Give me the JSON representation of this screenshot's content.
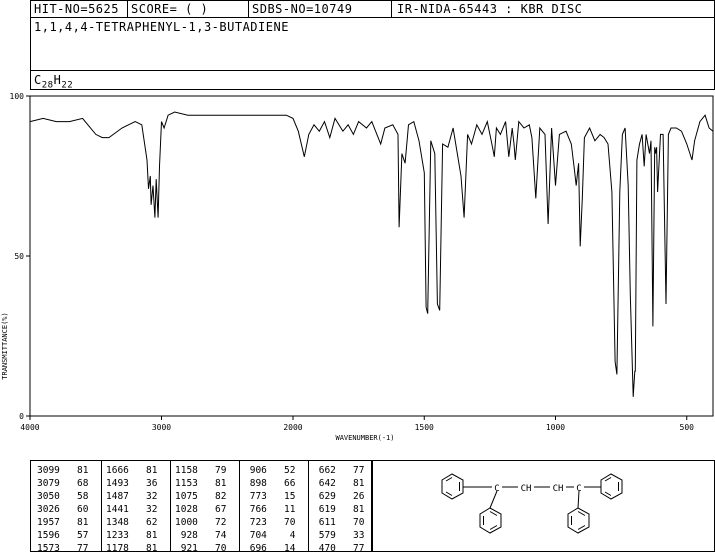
{
  "header": {
    "hit_no": "HIT-NO=5625",
    "score": "SCORE=  (   )",
    "sdbs_no": "SDBS-NO=10749",
    "ir_id": "IR-NIDA-65443 : KBR DISC",
    "compound": "1,1,4,4-TETRAPHENYL-1,3-BUTADIENE",
    "formula_base": "C",
    "formula_c": "28",
    "formula_h_label": "H",
    "formula_h": "22"
  },
  "chart_data": {
    "type": "line",
    "xlabel": "WAVENUMBER(-1)",
    "ylabel": "TRANSMITTANCE(%)",
    "xlim": [
      4000,
      400
    ],
    "ylim": [
      0,
      100
    ],
    "x_ticks": [
      "4000",
      "3000",
      "2000",
      "1500",
      "1000",
      "500"
    ],
    "y_ticks": [
      "100",
      "50",
      "0"
    ],
    "series": [
      {
        "x": [
          4000,
          3900,
          3800,
          3700,
          3600,
          3500,
          3450,
          3400,
          3300,
          3200,
          3150,
          3110,
          3099,
          3085,
          3079,
          3065,
          3050,
          3040,
          3026,
          3015,
          3000,
          2980,
          2950,
          2900,
          2800,
          2600,
          2400,
          2200,
          2100,
          2050,
          2000,
          1980,
          1957,
          1940,
          1920,
          1900,
          1880,
          1860,
          1840,
          1810,
          1790,
          1770,
          1750,
          1720,
          1700,
          1666,
          1650,
          1620,
          1600,
          1596,
          1585,
          1573,
          1560,
          1540,
          1520,
          1500,
          1493,
          1487,
          1475,
          1460,
          1450,
          1441,
          1430,
          1410,
          1390,
          1360,
          1348,
          1335,
          1320,
          1300,
          1280,
          1260,
          1240,
          1233,
          1225,
          1210,
          1190,
          1178,
          1165,
          1158,
          1153,
          1140,
          1120,
          1100,
          1090,
          1075,
          1060,
          1040,
          1028,
          1015,
          1000,
          985,
          960,
          940,
          928,
          921,
          912,
          906,
          898,
          890,
          870,
          850,
          830,
          815,
          800,
          785,
          773,
          766,
          755,
          745,
          735,
          723,
          715,
          704,
          698,
          696,
          690,
          680,
          670,
          662,
          655,
          642,
          636,
          629,
          622,
          619,
          615,
          611,
          600,
          590,
          579,
          570,
          560,
          540,
          520,
          500,
          480,
          470,
          450,
          430,
          415,
          400
        ],
        "y": [
          92,
          93,
          92,
          92,
          93,
          88,
          87,
          87,
          90,
          92,
          91,
          80,
          71,
          75,
          66,
          72,
          62,
          74,
          62,
          78,
          92,
          90,
          94,
          95,
          94,
          94,
          94,
          94,
          94,
          94,
          93,
          89,
          81,
          88,
          91,
          89,
          92,
          87,
          93,
          89,
          91,
          88,
          92,
          90,
          92,
          85,
          90,
          91,
          88,
          59,
          82,
          79,
          91,
          92,
          86,
          76,
          34,
          32,
          86,
          82,
          35,
          33,
          85,
          84,
          90,
          75,
          62,
          88,
          85,
          91,
          88,
          92,
          84,
          81,
          90,
          88,
          92,
          81,
          90,
          85,
          80,
          92,
          90,
          91,
          87,
          68,
          90,
          88,
          60,
          90,
          72,
          88,
          89,
          85,
          77,
          72,
          79,
          53,
          68,
          87,
          90,
          86,
          88,
          87,
          85,
          70,
          17,
          13,
          70,
          88,
          90,
          72,
          38,
          6,
          14,
          14,
          80,
          85,
          88,
          78,
          88,
          82,
          86,
          28,
          84,
          82,
          84,
          70,
          88,
          88,
          35,
          88,
          90,
          90,
          89,
          85,
          80,
          86,
          92,
          94,
          90,
          89
        ]
      }
    ]
  },
  "peaks": {
    "col1": [
      [
        "3099",
        "81"
      ],
      [
        "3079",
        "68"
      ],
      [
        "3050",
        "58"
      ],
      [
        "3026",
        "60"
      ],
      [
        "1957",
        "81"
      ],
      [
        "1596",
        "57"
      ],
      [
        "1573",
        "77"
      ]
    ],
    "col2": [
      [
        "1666",
        "81"
      ],
      [
        "1493",
        "36"
      ],
      [
        "1487",
        "32"
      ],
      [
        "1441",
        "32"
      ],
      [
        "1348",
        "62"
      ],
      [
        "1233",
        "81"
      ],
      [
        "1178",
        "81"
      ]
    ],
    "col3": [
      [
        "1158",
        "79"
      ],
      [
        "1153",
        "81"
      ],
      [
        "1075",
        "82"
      ],
      [
        "1028",
        "67"
      ],
      [
        "1000",
        "72"
      ],
      [
        "928",
        "74"
      ],
      [
        "921",
        "70"
      ]
    ],
    "col4": [
      [
        "906",
        "52"
      ],
      [
        "898",
        "66"
      ],
      [
        "773",
        "15"
      ],
      [
        "766",
        "11"
      ],
      [
        "723",
        "70"
      ],
      [
        "704",
        "4"
      ],
      [
        "696",
        "14"
      ]
    ],
    "col5": [
      [
        "662",
        "77"
      ],
      [
        "642",
        "81"
      ],
      [
        "629",
        "26"
      ],
      [
        "619",
        "81"
      ],
      [
        "611",
        "70"
      ],
      [
        "579",
        "33"
      ],
      [
        "470",
        "77"
      ]
    ]
  },
  "structure": {
    "ch_left": "CH",
    "ch_right": "CH",
    "c_left": "C",
    "c_right": "C"
  }
}
